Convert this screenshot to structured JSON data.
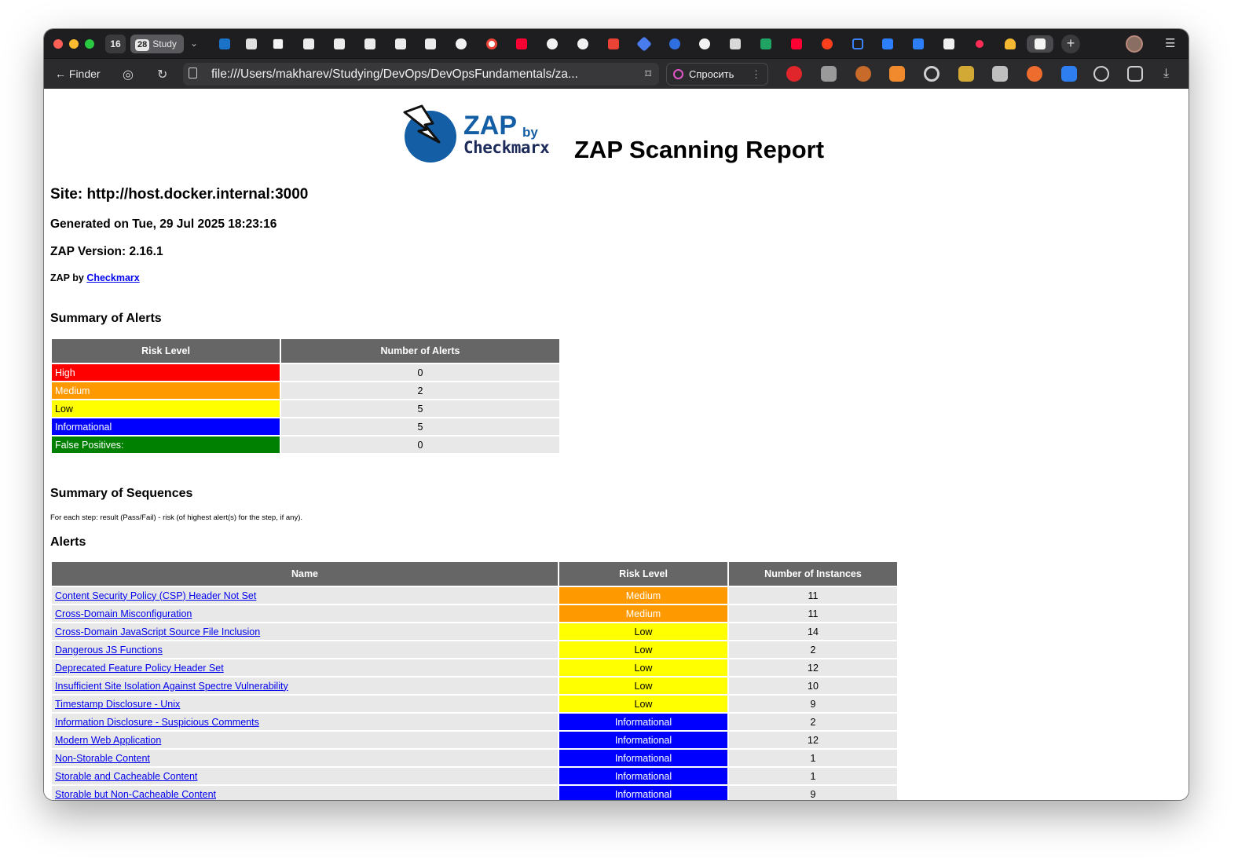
{
  "browser": {
    "tab_count": "16",
    "group_count": "28",
    "group_label": "Study",
    "back_label": "Finder",
    "url": "file:///Users/makharev/Studying/DevOps/DevOpsFundamentals/za...",
    "ask_label": "Спросить"
  },
  "report": {
    "logo_zap": "ZAP",
    "logo_by": "by",
    "logo_checkmarx": "Checkmarx",
    "title": "ZAP Scanning Report",
    "site": "Site: http://host.docker.internal:3000",
    "generated": "Generated on Tue, 29 Jul 2025 18:23:16",
    "version": "ZAP Version: 2.16.1",
    "zap_by_prefix": "ZAP by ",
    "zap_by_link": "Checkmarx",
    "summary_heading": "Summary of Alerts",
    "summary_headers": [
      "Risk Level",
      "Number of Alerts"
    ],
    "summary_rows": [
      {
        "level": "High",
        "count": "0"
      },
      {
        "level": "Medium",
        "count": "2"
      },
      {
        "level": "Low",
        "count": "5"
      },
      {
        "level": "Informational",
        "count": "5"
      },
      {
        "level": "False Positives:",
        "count": "0"
      }
    ],
    "sequences_heading": "Summary of Sequences",
    "sequences_note": "For each step: result (Pass/Fail) - risk (of highest alert(s) for the step, if any).",
    "alerts_heading": "Alerts",
    "alerts_headers": [
      "Name",
      "Risk Level",
      "Number of Instances"
    ],
    "alerts": [
      {
        "name": "Content Security Policy (CSP) Header Not Set",
        "risk": "Medium",
        "instances": "11"
      },
      {
        "name": "Cross-Domain Misconfiguration",
        "risk": "Medium",
        "instances": "11"
      },
      {
        "name": "Cross-Domain JavaScript Source File Inclusion",
        "risk": "Low",
        "instances": "14"
      },
      {
        "name": "Dangerous JS Functions",
        "risk": "Low",
        "instances": "2"
      },
      {
        "name": "Deprecated Feature Policy Header Set",
        "risk": "Low",
        "instances": "12"
      },
      {
        "name": "Insufficient Site Isolation Against Spectre Vulnerability",
        "risk": "Low",
        "instances": "10"
      },
      {
        "name": "Timestamp Disclosure - Unix",
        "risk": "Low",
        "instances": "9"
      },
      {
        "name": "Information Disclosure - Suspicious Comments",
        "risk": "Informational",
        "instances": "2"
      },
      {
        "name": "Modern Web Application",
        "risk": "Informational",
        "instances": "12"
      },
      {
        "name": "Non-Storable Content",
        "risk": "Informational",
        "instances": "1"
      },
      {
        "name": "Storable and Cacheable Content",
        "risk": "Informational",
        "instances": "1"
      },
      {
        "name": "Storable but Non-Cacheable Content",
        "risk": "Informational",
        "instances": "9"
      }
    ]
  },
  "colors": {
    "high": "#ff0000",
    "medium": "#ff9900",
    "low": "#ffff00",
    "informational": "#0000ff",
    "false_positive": "#008000",
    "header": "#666666",
    "zap_blue": "#135ea5"
  }
}
